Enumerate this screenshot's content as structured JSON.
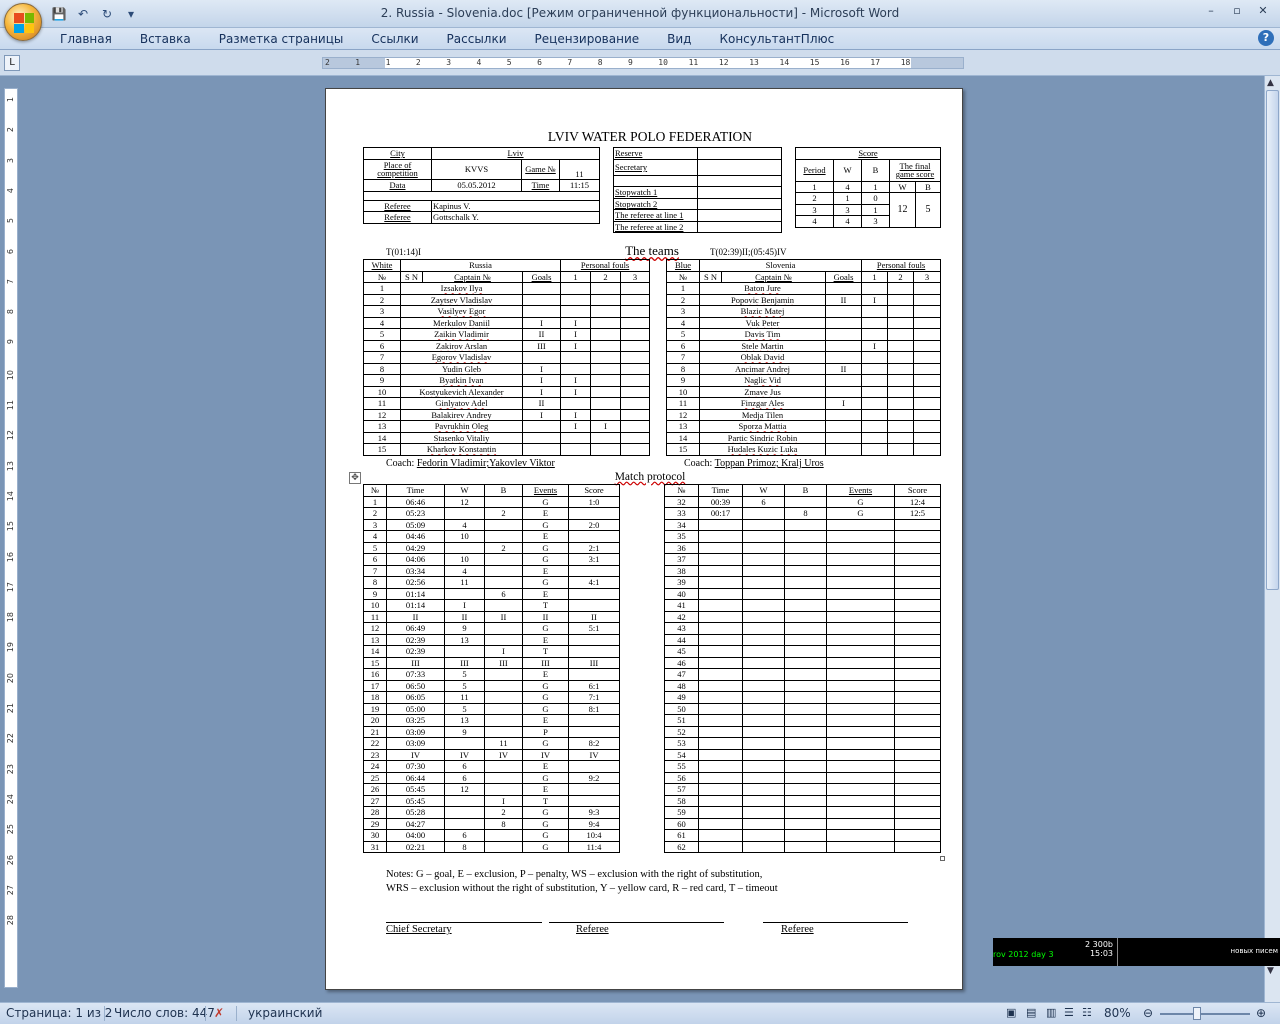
{
  "window": {
    "title": "2. Russia - Slovenia.doc [Режим ограниченной функциональности] - Microsoft Word",
    "controls": [
      "–",
      "▫",
      "✕"
    ]
  },
  "ribbon": {
    "tabs": [
      "Главная",
      "Вставка",
      "Разметка страницы",
      "Ссылки",
      "Рассылки",
      "Рецензирование",
      "Вид",
      "КонсультантПлюс"
    ]
  },
  "ruler": {
    "ticks": [
      "2",
      "1",
      "1",
      "2",
      "3",
      "4",
      "5",
      "6",
      "7",
      "8",
      "9",
      "10",
      "11",
      "12",
      "13",
      "14",
      "15",
      "16",
      "17",
      "18"
    ]
  },
  "vruler_ticks": [
    "1",
    "2",
    "3",
    "4",
    "5",
    "6",
    "7",
    "8",
    "9",
    "10",
    "11",
    "12",
    "13",
    "14",
    "15",
    "16",
    "17",
    "18",
    "19",
    "20",
    "21",
    "22",
    "23",
    "24",
    "25",
    "26",
    "27",
    "28"
  ],
  "doc": {
    "title": "LVIV WATER POLO FEDERATION",
    "info": {
      "city_label": "City",
      "city": "Lviv",
      "place_label": "Place of competition",
      "place": "KVVS",
      "game_label": "Game №",
      "game": "11",
      "date_label": "Data",
      "date": "05.05.2012",
      "time_label": "Time",
      "time": "11:15",
      "ref1_label": "Referee",
      "ref1": "Kapinus V.",
      "ref2_label": "Referee",
      "ref2": "Gottschalk Y."
    },
    "officials": [
      "Reserve",
      "Secretary",
      "Stopwatch 1",
      "Stopwatch 2",
      "The referee at line 1",
      "The referee at line 2"
    ],
    "score": {
      "header": "Score",
      "period_label": "Period",
      "w": "W",
      "b": "B",
      "final_label": "The final game score",
      "periods": [
        [
          "1",
          "4",
          "1"
        ],
        [
          "2",
          "1",
          "0"
        ],
        [
          "3",
          "3",
          "1"
        ],
        [
          "4",
          "4",
          "3"
        ]
      ],
      "final_w": "12",
      "final_b": "5"
    },
    "teams_title": "The teams",
    "timeouts_left": "T(01:14)I",
    "timeouts_right": "T(02:39)II;(05:45)IV",
    "left_team": {
      "color": "White",
      "name": "Russia",
      "fouls_label": "Personal fouls",
      "cols": [
        "№",
        "S N",
        "Captain №",
        "Goals",
        "1",
        "2",
        "3"
      ],
      "players": [
        [
          "1",
          "Izsakov Ilya",
          "",
          "",
          "",
          ""
        ],
        [
          "2",
          "Zaytsev Vladislav",
          "",
          "",
          "",
          ""
        ],
        [
          "3",
          "Vasilyev Egor",
          "",
          "",
          "",
          ""
        ],
        [
          "4",
          "Merkulov Daniil",
          "I",
          "I",
          "",
          ""
        ],
        [
          "5",
          "Zaikin Vladimir",
          "II",
          "I",
          "",
          ""
        ],
        [
          "6",
          "Zakirov Arslan",
          "III",
          "I",
          "",
          ""
        ],
        [
          "7",
          "Egorov Vladislav",
          "",
          "",
          "",
          ""
        ],
        [
          "8",
          "Yudin Gleb",
          "I",
          "",
          "",
          ""
        ],
        [
          "9",
          "Byatkin Ivan",
          "I",
          "I",
          "",
          ""
        ],
        [
          "10",
          "Kostyukevich Alexander",
          "I",
          "I",
          "",
          ""
        ],
        [
          "11",
          "Ginlyatov Adel",
          "II",
          "",
          "",
          ""
        ],
        [
          "12",
          "Balakirev Andrey",
          "I",
          "I",
          "",
          ""
        ],
        [
          "13",
          "Pavrukhin Oleg",
          "",
          "I",
          "I",
          ""
        ],
        [
          "14",
          "Stasenko Vitaliy",
          "",
          "",
          "",
          ""
        ],
        [
          "15",
          "Kharkov Konstantin",
          "",
          "",
          "",
          ""
        ]
      ],
      "coach_label": "Coach:",
      "coach": "Fedorin Vladimir;Yakovlev Viktor"
    },
    "right_team": {
      "color": "Blue",
      "name": "Slovenia",
      "fouls_label": "Personal fouls",
      "cols": [
        "№",
        "S N",
        "Captain №",
        "Goals",
        "1",
        "2",
        "3"
      ],
      "players": [
        [
          "1",
          "Baton Jure",
          "",
          "",
          "",
          ""
        ],
        [
          "2",
          "Popovic Benjamin",
          "II",
          "I",
          "",
          ""
        ],
        [
          "3",
          "Blazic Matej",
          "",
          "",
          "",
          ""
        ],
        [
          "4",
          "Vuk Peter",
          "",
          "",
          "",
          ""
        ],
        [
          "5",
          "Davis Tim",
          "",
          "",
          "",
          ""
        ],
        [
          "6",
          "Stele Martin",
          "",
          "I",
          "",
          ""
        ],
        [
          "7",
          "Oblak David",
          "",
          "",
          "",
          ""
        ],
        [
          "8",
          "Ancimar Andrej",
          "II",
          "",
          "",
          ""
        ],
        [
          "9",
          "Naglic Vid",
          "",
          "",
          "",
          ""
        ],
        [
          "10",
          "Zmave Jus",
          "",
          "",
          "",
          ""
        ],
        [
          "11",
          "Finzgar Ales",
          "I",
          "",
          "",
          ""
        ],
        [
          "12",
          "Medja Tilen",
          "",
          "",
          "",
          ""
        ],
        [
          "13",
          "Sporza Mattia",
          "",
          "",
          "",
          ""
        ],
        [
          "14",
          "Partic Sindric Robin",
          "",
          "",
          "",
          ""
        ],
        [
          "15",
          "Hudales Kuzic Luka",
          "",
          "",
          "",
          ""
        ]
      ],
      "coach_label": "Coach:",
      "coach": "Toppan Primoz; Kralj Uros"
    },
    "protocol_title": "Match protocol",
    "protocol_cols": [
      "№",
      "Time",
      "W",
      "B",
      "Events",
      "Score"
    ],
    "protocol_left": [
      [
        "1",
        "06:46",
        "12",
        "",
        "G",
        "1:0"
      ],
      [
        "2",
        "05:23",
        "",
        "2",
        "E",
        ""
      ],
      [
        "3",
        "05:09",
        "4",
        "",
        "G",
        "2:0"
      ],
      [
        "4",
        "04:46",
        "10",
        "",
        "E",
        ""
      ],
      [
        "5",
        "04:29",
        "",
        "2",
        "G",
        "2:1"
      ],
      [
        "6",
        "04:06",
        "10",
        "",
        "G",
        "3:1"
      ],
      [
        "7",
        "03:34",
        "4",
        "",
        "E",
        ""
      ],
      [
        "8",
        "02:56",
        "11",
        "",
        "G",
        "4:1"
      ],
      [
        "9",
        "01:14",
        "",
        "6",
        "E",
        ""
      ],
      [
        "10",
        "01:14",
        "I",
        "",
        "T",
        ""
      ],
      [
        "11",
        "II",
        "II",
        "II",
        "II",
        "II"
      ],
      [
        "12",
        "06:49",
        "9",
        "",
        "G",
        "5:1"
      ],
      [
        "13",
        "02:39",
        "13",
        "",
        "E",
        ""
      ],
      [
        "14",
        "02:39",
        "",
        "I",
        "T",
        ""
      ],
      [
        "15",
        "III",
        "III",
        "III",
        "III",
        "III"
      ],
      [
        "16",
        "07:33",
        "5",
        "",
        "E",
        ""
      ],
      [
        "17",
        "06:50",
        "5",
        "",
        "G",
        "6:1"
      ],
      [
        "18",
        "06:05",
        "11",
        "",
        "G",
        "7:1"
      ],
      [
        "19",
        "05:00",
        "5",
        "",
        "G",
        "8:1"
      ],
      [
        "20",
        "03:25",
        "13",
        "",
        "E",
        ""
      ],
      [
        "21",
        "03:09",
        "9",
        "",
        "P",
        ""
      ],
      [
        "22",
        "03:09",
        "",
        "11",
        "G",
        "8:2"
      ],
      [
        "23",
        "IV",
        "IV",
        "IV",
        "IV",
        "IV"
      ],
      [
        "24",
        "07:30",
        "6",
        "",
        "E",
        ""
      ],
      [
        "25",
        "06:44",
        "6",
        "",
        "G",
        "9:2"
      ],
      [
        "26",
        "05:45",
        "12",
        "",
        "E",
        ""
      ],
      [
        "27",
        "05:45",
        "",
        "I",
        "T",
        ""
      ],
      [
        "28",
        "05:28",
        "",
        "2",
        "G",
        "9:3"
      ],
      [
        "29",
        "04:27",
        "",
        "8",
        "G",
        "9:4"
      ],
      [
        "30",
        "04:00",
        "6",
        "",
        "G",
        "10:4"
      ],
      [
        "31",
        "02:21",
        "8",
        "",
        "G",
        "11:4"
      ]
    ],
    "protocol_right": [
      [
        "32",
        "00:39",
        "6",
        "",
        "G",
        "12:4"
      ],
      [
        "33",
        "00:17",
        "",
        "8",
        "G",
        "12:5"
      ],
      [
        "34",
        "",
        "",
        "",
        "",
        ""
      ],
      [
        "35",
        "",
        "",
        "",
        "",
        ""
      ],
      [
        "36",
        "",
        "",
        "",
        "",
        ""
      ],
      [
        "37",
        "",
        "",
        "",
        "",
        ""
      ],
      [
        "38",
        "",
        "",
        "",
        "",
        ""
      ],
      [
        "39",
        "",
        "",
        "",
        "",
        ""
      ],
      [
        "40",
        "",
        "",
        "",
        "",
        ""
      ],
      [
        "41",
        "",
        "",
        "",
        "",
        ""
      ],
      [
        "42",
        "",
        "",
        "",
        "",
        ""
      ],
      [
        "43",
        "",
        "",
        "",
        "",
        ""
      ],
      [
        "44",
        "",
        "",
        "",
        "",
        ""
      ],
      [
        "45",
        "",
        "",
        "",
        "",
        ""
      ],
      [
        "46",
        "",
        "",
        "",
        "",
        ""
      ],
      [
        "47",
        "",
        "",
        "",
        "",
        ""
      ],
      [
        "48",
        "",
        "",
        "",
        "",
        ""
      ],
      [
        "49",
        "",
        "",
        "",
        "",
        ""
      ],
      [
        "50",
        "",
        "",
        "",
        "",
        ""
      ],
      [
        "51",
        "",
        "",
        "",
        "",
        ""
      ],
      [
        "52",
        "",
        "",
        "",
        "",
        ""
      ],
      [
        "53",
        "",
        "",
        "",
        "",
        ""
      ],
      [
        "54",
        "",
        "",
        "",
        "",
        ""
      ],
      [
        "55",
        "",
        "",
        "",
        "",
        ""
      ],
      [
        "56",
        "",
        "",
        "",
        "",
        ""
      ],
      [
        "57",
        "",
        "",
        "",
        "",
        ""
      ],
      [
        "58",
        "",
        "",
        "",
        "",
        ""
      ],
      [
        "59",
        "",
        "",
        "",
        "",
        ""
      ],
      [
        "60",
        "",
        "",
        "",
        "",
        ""
      ],
      [
        "61",
        "",
        "",
        "",
        "",
        ""
      ],
      [
        "62",
        "",
        "",
        "",
        "",
        ""
      ]
    ],
    "notes_1": "Notes: G – goal, E – exclusion, P – penalty, WS – exclusion with the right of substitution,",
    "notes_2": "WRS – exclusion without the right of substitution, Y – yellow card,  R – red card, T – timeout",
    "sign_chief": "Chief Secretary",
    "sign_ref1": "Referee",
    "sign_ref2": "Referee"
  },
  "status": {
    "page": "Страница: 1 из 2",
    "words": "Число слов: 447",
    "lang": "украинский",
    "zoom": "80%"
  },
  "tray": {
    "t1": "rov 2012 day 3",
    "t2a": "2 300b",
    "t2b": "15:03",
    "t3": "новых писем"
  },
  "colors": {
    "titlebar": "#c3d5ea",
    "workspace": "#7a95b6",
    "accent": "#2f6fb9"
  }
}
